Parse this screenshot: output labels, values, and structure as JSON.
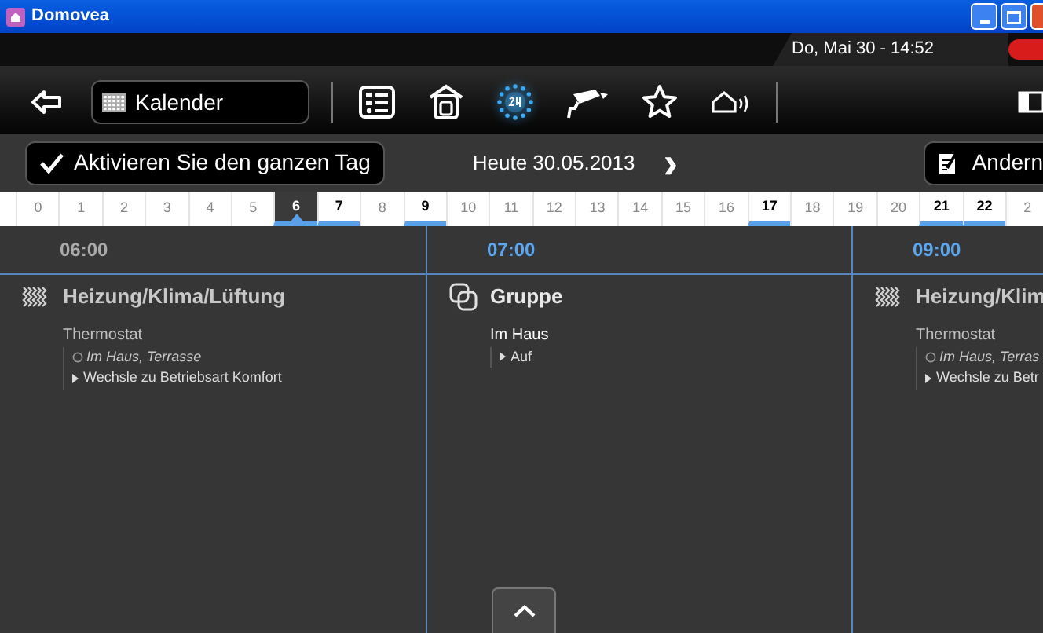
{
  "window": {
    "title": "Domovea"
  },
  "status_bar": {
    "datetime": "Do, Mai 30 - 14:52"
  },
  "toolbar": {
    "view_selector": "Kalender",
    "tools": [
      {
        "kind": "list",
        "selected": false
      },
      {
        "kind": "house",
        "selected": false
      },
      {
        "kind": "clock24",
        "selected": true
      },
      {
        "kind": "camera",
        "selected": false
      },
      {
        "kind": "star",
        "selected": false
      },
      {
        "kind": "alarm",
        "selected": false
      }
    ]
  },
  "action_bar": {
    "activate_button": "Aktivieren Sie den ganzen Tag",
    "date": "Heute 30.05.2013",
    "next": "›",
    "edit_button": "Andern"
  },
  "hours": [
    {
      "label": "0",
      "has_events": false,
      "selected": false
    },
    {
      "label": "1",
      "has_events": false,
      "selected": false
    },
    {
      "label": "2",
      "has_events": false,
      "selected": false
    },
    {
      "label": "3",
      "has_events": false,
      "selected": false
    },
    {
      "label": "4",
      "has_events": false,
      "selected": false
    },
    {
      "label": "5",
      "has_events": false,
      "selected": false
    },
    {
      "label": "6",
      "has_events": true,
      "selected": true
    },
    {
      "label": "7",
      "has_events": true,
      "selected": false
    },
    {
      "label": "8",
      "has_events": false,
      "selected": false
    },
    {
      "label": "9",
      "has_events": true,
      "selected": false
    },
    {
      "label": "10",
      "has_events": false,
      "selected": false
    },
    {
      "label": "11",
      "has_events": false,
      "selected": false
    },
    {
      "label": "12",
      "has_events": false,
      "selected": false
    },
    {
      "label": "13",
      "has_events": false,
      "selected": false
    },
    {
      "label": "14",
      "has_events": false,
      "selected": false
    },
    {
      "label": "15",
      "has_events": false,
      "selected": false
    },
    {
      "label": "16",
      "has_events": false,
      "selected": false
    },
    {
      "label": "17",
      "has_events": true,
      "selected": false
    },
    {
      "label": "18",
      "has_events": false,
      "selected": false
    },
    {
      "label": "19",
      "has_events": false,
      "selected": false
    },
    {
      "label": "20",
      "has_events": false,
      "selected": false
    },
    {
      "label": "21",
      "has_events": true,
      "selected": false
    },
    {
      "label": "22",
      "has_events": true,
      "selected": false
    },
    {
      "label": "2",
      "has_events": false,
      "selected": false
    }
  ],
  "columns": [
    {
      "time": "06:00",
      "current": false,
      "event": {
        "kind": "climate",
        "title": "Heizung/Klima/Lüftung",
        "device": "Thermostat",
        "location": "Im Haus, Terrasse",
        "action": "Wechsle zu Betriebsart Komfort"
      }
    },
    {
      "time": "07:00",
      "current": true,
      "event": {
        "kind": "group",
        "title": "Gruppe",
        "device": "Im Haus",
        "action": "Auf"
      }
    },
    {
      "time": "09:00",
      "current": true,
      "event": {
        "kind": "climate",
        "title": "Heizung/Klim",
        "device": "Thermostat",
        "location": "Im Haus, Terras",
        "action": "Wechsle zu Betr"
      }
    }
  ]
}
